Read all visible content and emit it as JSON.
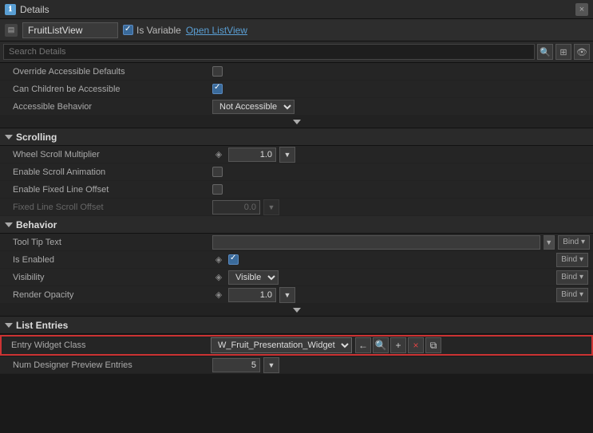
{
  "titleBar": {
    "title": "Details",
    "closeLabel": "×"
  },
  "toolbar": {
    "variableName": "FruitListView",
    "isVariableLabel": "Is Variable",
    "openListViewLabel": "Open ListView"
  },
  "searchBar": {
    "placeholder": "Search Details"
  },
  "sections": {
    "accessibility": {
      "overrideAccessibleDefaultsLabel": "Override Accessible Defaults",
      "canChildrenBeAccessibleLabel": "Can Children be Accessible",
      "accessibleBehaviorLabel": "Accessible Behavior",
      "accessibleBehaviorValue": "Not Accessible ▾"
    },
    "scrolling": {
      "title": "Scrolling",
      "wheelScrollMultiplierLabel": "Wheel Scroll Multiplier",
      "wheelScrollMultiplierValue": "1.0",
      "enableScrollAnimationLabel": "Enable Scroll Animation",
      "enableFixedLineOffsetLabel": "Enable Fixed Line Offset",
      "fixedLineScrollOffsetLabel": "Fixed Line Scroll Offset",
      "fixedLineScrollOffsetValue": "0.0"
    },
    "behavior": {
      "title": "Behavior",
      "toolTipTextLabel": "Tool Tip Text",
      "isEnabledLabel": "Is Enabled",
      "visibilityLabel": "Visibility",
      "visibilityValue": "Visible",
      "renderOpacityLabel": "Render Opacity",
      "renderOpacityValue": "1.0",
      "bindLabel": "Bind ▾"
    },
    "listEntries": {
      "title": "List Entries",
      "entryWidgetClassLabel": "Entry Widget Class",
      "entryWidgetClassValue": "W_Fruit_Presentation_Widget ▾",
      "numDesignerPreviewEntriesLabel": "Num Designer Preview Entries",
      "numDesignerPreviewEntriesValue": "5"
    }
  },
  "icons": {
    "triangle": "▼",
    "triangleRight": "▶",
    "search": "🔍",
    "viewGrid": "⊞",
    "viewList": "☰",
    "arrowLeft": "←",
    "arrowRight": "→",
    "plus": "+",
    "cross": "×",
    "box": "⧉",
    "pin": "◈"
  }
}
